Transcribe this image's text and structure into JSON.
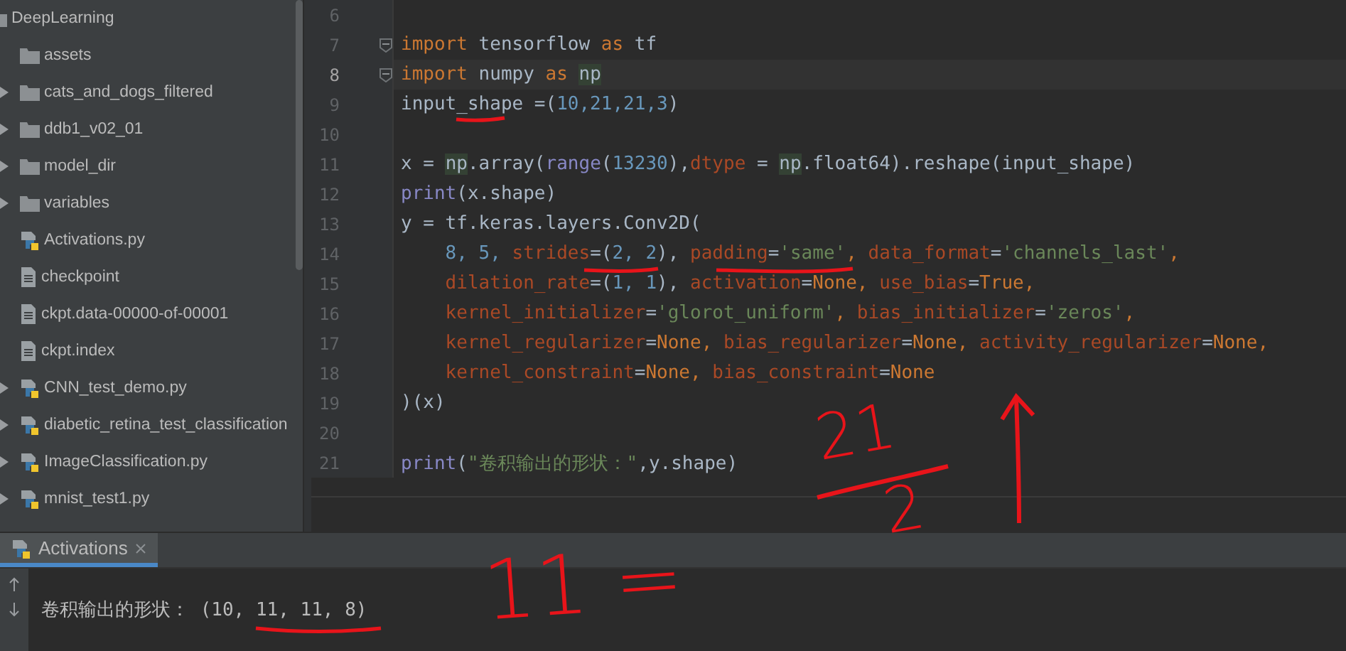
{
  "project_tree": {
    "root": {
      "label": "DeepLearning",
      "kind": "folder",
      "children": [
        {
          "label": "assets",
          "kind": "folder",
          "expandable": false
        },
        {
          "label": "cats_and_dogs_filtered",
          "kind": "folder",
          "expandable": true
        },
        {
          "label": "ddb1_v02_01",
          "kind": "folder",
          "expandable": true
        },
        {
          "label": "model_dir",
          "kind": "folder",
          "expandable": true
        },
        {
          "label": "variables",
          "kind": "folder",
          "expandable": true
        },
        {
          "label": "Activations.py",
          "kind": "python",
          "expandable": false
        },
        {
          "label": "checkpoint",
          "kind": "file",
          "expandable": false
        },
        {
          "label": "ckpt.data-00000-of-00001",
          "kind": "file",
          "expandable": false
        },
        {
          "label": "ckpt.index",
          "kind": "file",
          "expandable": false
        },
        {
          "label": "CNN_test_demo.py",
          "kind": "python",
          "expandable": true
        },
        {
          "label": "diabetic_retina_test_classification",
          "kind": "python",
          "expandable": true
        },
        {
          "label": "ImageClassification.py",
          "kind": "python",
          "expandable": true
        },
        {
          "label": "mnist_test1.py",
          "kind": "python",
          "expandable": true
        }
      ]
    }
  },
  "editor": {
    "lines": [
      {
        "number": "6",
        "current": false,
        "fold": false
      },
      {
        "number": "7",
        "current": false,
        "fold": true,
        "tokens": [
          {
            "t": "import",
            "kind": "keyword"
          },
          {
            "t": " tensorflow ",
            "kind": "plain"
          },
          {
            "t": "as",
            "kind": "keyword"
          },
          {
            "t": " tf",
            "kind": "plain"
          }
        ]
      },
      {
        "number": "8",
        "current": true,
        "fold": true,
        "tokens": [
          {
            "t": "import",
            "kind": "keyword"
          },
          {
            "t": " numpy ",
            "kind": "plain"
          },
          {
            "t": "as ",
            "kind": "keyword"
          },
          {
            "t": "np",
            "kind": "highlight"
          }
        ]
      },
      {
        "number": "9",
        "current": false,
        "fold": false,
        "tokens": [
          {
            "t": "input_shape =(",
            "kind": "plain"
          },
          {
            "t": "10,21,21,3",
            "kind": "number"
          },
          {
            "t": ")",
            "kind": "plain"
          }
        ]
      },
      {
        "number": "10",
        "current": false,
        "fold": false
      },
      {
        "number": "11",
        "current": false,
        "fold": false,
        "tokens": [
          {
            "t": "x = ",
            "kind": "plain"
          },
          {
            "t": "np",
            "kind": "highlight"
          },
          {
            "t": ".array(",
            "kind": "plain"
          },
          {
            "t": "range",
            "kind": "builtin"
          },
          {
            "t": "(",
            "kind": "plain"
          },
          {
            "t": "13230",
            "kind": "number"
          },
          {
            "t": "),",
            "kind": "plain"
          },
          {
            "t": "dtype",
            "kind": "param"
          },
          {
            "t": " = ",
            "kind": "plain"
          },
          {
            "t": "np",
            "kind": "highlight"
          },
          {
            "t": ".float64).reshape(input_shape)",
            "kind": "plain"
          }
        ]
      },
      {
        "number": "12",
        "current": false,
        "fold": false,
        "tokens": [
          {
            "t": "print",
            "kind": "builtin"
          },
          {
            "t": "(x.shape)",
            "kind": "plain"
          }
        ]
      },
      {
        "number": "13",
        "current": false,
        "fold": false,
        "tokens": [
          {
            "t": "y = tf.keras.layers.Conv2D(",
            "kind": "plain"
          }
        ]
      },
      {
        "number": "14",
        "current": false,
        "fold": false,
        "tokens": [
          {
            "t": "    8, 5, ",
            "kind": "number"
          },
          {
            "t": "strides",
            "kind": "param"
          },
          {
            "t": "=(",
            "kind": "plain"
          },
          {
            "t": "2, 2",
            "kind": "number"
          },
          {
            "t": "), ",
            "kind": "plain"
          },
          {
            "t": "padding",
            "kind": "param"
          },
          {
            "t": "=",
            "kind": "plain"
          },
          {
            "t": "'same'",
            "kind": "string"
          },
          {
            "t": ", ",
            "kind": "keyword"
          },
          {
            "t": "data_format",
            "kind": "param"
          },
          {
            "t": "=",
            "kind": "plain"
          },
          {
            "t": "'channels_last'",
            "kind": "string"
          },
          {
            "t": ",",
            "kind": "keyword"
          }
        ]
      },
      {
        "number": "15",
        "current": false,
        "fold": false,
        "tokens": [
          {
            "t": "    dilation_rate",
            "kind": "param"
          },
          {
            "t": "=(",
            "kind": "plain"
          },
          {
            "t": "1, 1",
            "kind": "number"
          },
          {
            "t": "), ",
            "kind": "plain"
          },
          {
            "t": "activation",
            "kind": "param"
          },
          {
            "t": "=",
            "kind": "plain"
          },
          {
            "t": "None, ",
            "kind": "keyword"
          },
          {
            "t": "use_bias",
            "kind": "param"
          },
          {
            "t": "=",
            "kind": "plain"
          },
          {
            "t": "True,",
            "kind": "keyword"
          }
        ]
      },
      {
        "number": "16",
        "current": false,
        "fold": false,
        "tokens": [
          {
            "t": "    kernel_initializer",
            "kind": "param"
          },
          {
            "t": "=",
            "kind": "plain"
          },
          {
            "t": "'glorot_uniform'",
            "kind": "string"
          },
          {
            "t": ", ",
            "kind": "keyword"
          },
          {
            "t": "bias_initializer",
            "kind": "param"
          },
          {
            "t": "=",
            "kind": "plain"
          },
          {
            "t": "'zeros'",
            "kind": "string"
          },
          {
            "t": ",",
            "kind": "keyword"
          }
        ]
      },
      {
        "number": "17",
        "current": false,
        "fold": false,
        "tokens": [
          {
            "t": "    kernel_regularizer",
            "kind": "param"
          },
          {
            "t": "=",
            "kind": "plain"
          },
          {
            "t": "None, ",
            "kind": "keyword"
          },
          {
            "t": "bias_regularizer",
            "kind": "param"
          },
          {
            "t": "=",
            "kind": "plain"
          },
          {
            "t": "None, ",
            "kind": "keyword"
          },
          {
            "t": "activity_regularizer",
            "kind": "param"
          },
          {
            "t": "=",
            "kind": "plain"
          },
          {
            "t": "None,",
            "kind": "keyword"
          }
        ]
      },
      {
        "number": "18",
        "current": false,
        "fold": false,
        "tokens": [
          {
            "t": "    kernel_constraint",
            "kind": "param"
          },
          {
            "t": "=",
            "kind": "plain"
          },
          {
            "t": "None, ",
            "kind": "keyword"
          },
          {
            "t": "bias_constraint",
            "kind": "param"
          },
          {
            "t": "=",
            "kind": "plain"
          },
          {
            "t": "None",
            "kind": "keyword"
          }
        ]
      },
      {
        "number": "19",
        "current": false,
        "fold": false,
        "tokens": [
          {
            "t": ")(x)",
            "kind": "plain"
          }
        ]
      },
      {
        "number": "20",
        "current": false,
        "fold": false
      },
      {
        "number": "21",
        "current": false,
        "fold": false,
        "tokens": [
          {
            "t": "print",
            "kind": "builtin"
          },
          {
            "t": "(",
            "kind": "plain"
          },
          {
            "t": "\"卷积输出的形状：\"",
            "kind": "string"
          },
          {
            "t": ",y.shape)",
            "kind": "plain"
          }
        ]
      }
    ]
  },
  "run_panel": {
    "tabs": [
      {
        "label": "Activations",
        "selected": true
      }
    ],
    "output": "卷积输出的形状： (10, 11, 11, 8)"
  },
  "handwritten_notes": {
    "left": "11 =",
    "numerator": "21",
    "denominator": "2"
  }
}
